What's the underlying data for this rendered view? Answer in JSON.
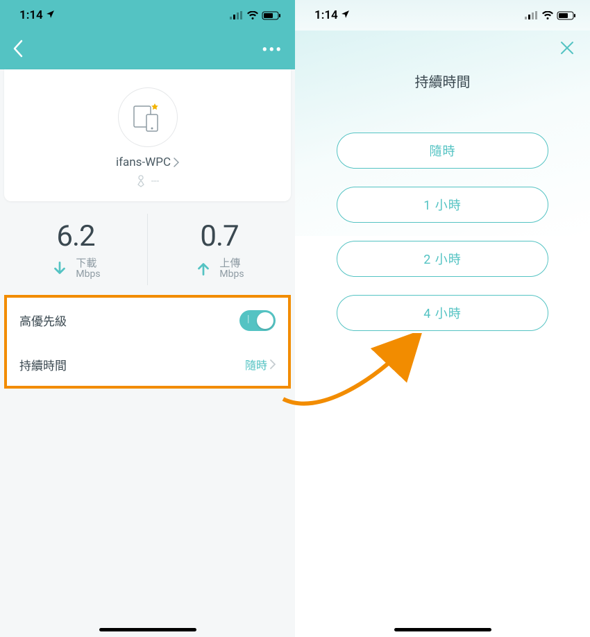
{
  "status": {
    "time": "1:14",
    "location_icon": "➤"
  },
  "left": {
    "device_name": "ifans-WPC",
    "device_sub_dash": "---",
    "download": {
      "value": "6.2",
      "label": "下載",
      "unit": "Mbps"
    },
    "upload": {
      "value": "0.7",
      "label": "上傳",
      "unit": "Mbps"
    },
    "priority_label": "高優先級",
    "duration_label": "持續時間",
    "duration_value": "隨時"
  },
  "right": {
    "title": "持續時間",
    "options": [
      "隨時",
      "1 小時",
      "2 小時",
      "4 小時"
    ]
  },
  "colors": {
    "teal": "#54c3c3",
    "orange": "#f28c00"
  }
}
